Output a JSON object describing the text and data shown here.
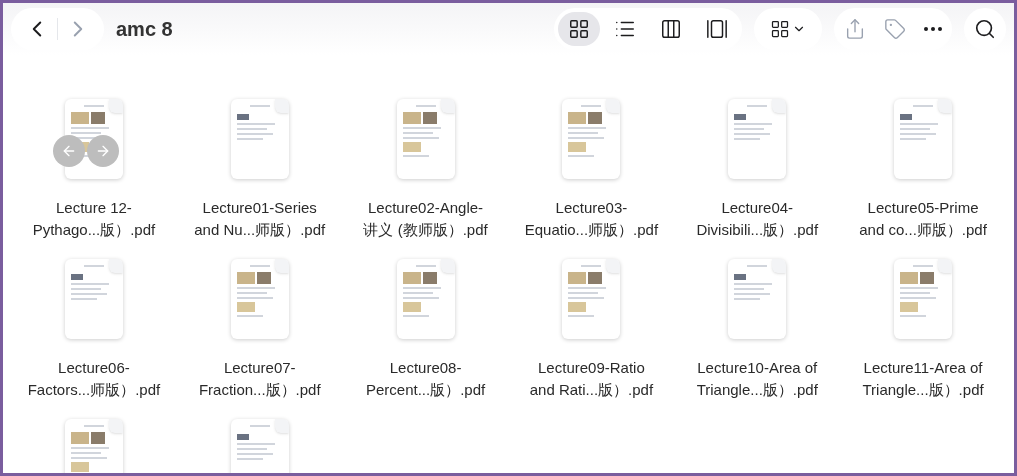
{
  "toolbar": {
    "title": "amc 8",
    "view_modes": [
      {
        "kind": "grid",
        "selected": true
      },
      {
        "kind": "list",
        "selected": false
      },
      {
        "kind": "columns",
        "selected": false
      },
      {
        "kind": "gallery",
        "selected": false
      }
    ]
  },
  "files": [
    {
      "name_line_1": "Lecture 12-",
      "name_line_2": "Pythago...版）.pdf",
      "kind": "photo",
      "nav_arrows": true
    },
    {
      "name_line_1": "Lecture01-Series",
      "name_line_2": "and Nu...师版）.pdf",
      "kind": "text",
      "nav_arrows": false
    },
    {
      "name_line_1": "Lecture02-Angle-",
      "name_line_2": "讲义 (教师版）.pdf",
      "kind": "photo",
      "nav_arrows": false
    },
    {
      "name_line_1": "Lecture03-",
      "name_line_2": "Equatio...师版）.pdf",
      "kind": "photo",
      "nav_arrows": false
    },
    {
      "name_line_1": "Lecture04-",
      "name_line_2": "Divisibili...版）.pdf",
      "kind": "text",
      "nav_arrows": false
    },
    {
      "name_line_1": "Lecture05-Prime",
      "name_line_2": "and co...师版）.pdf",
      "kind": "text",
      "nav_arrows": false
    },
    {
      "name_line_1": "Lecture06-",
      "name_line_2": "Factors...师版）.pdf",
      "kind": "text",
      "nav_arrows": false
    },
    {
      "name_line_1": "Lecture07-",
      "name_line_2": "Fraction...版）.pdf",
      "kind": "photo",
      "nav_arrows": false
    },
    {
      "name_line_1": "Lecture08-",
      "name_line_2": "Percent...版）.pdf",
      "kind": "photo",
      "nav_arrows": false
    },
    {
      "name_line_1": "Lecture09-Ratio",
      "name_line_2": "and Rati...版）.pdf",
      "kind": "photo",
      "nav_arrows": false
    },
    {
      "name_line_1": "Lecture10-Area of",
      "name_line_2": "Triangle...版）.pdf",
      "kind": "text",
      "nav_arrows": false
    },
    {
      "name_line_1": "Lecture11-Area of",
      "name_line_2": "Triangle...版）.pdf",
      "kind": "photo",
      "nav_arrows": false
    },
    {
      "kind": "photo",
      "nav_arrows": false
    },
    {
      "kind": "text",
      "nav_arrows": false
    }
  ]
}
